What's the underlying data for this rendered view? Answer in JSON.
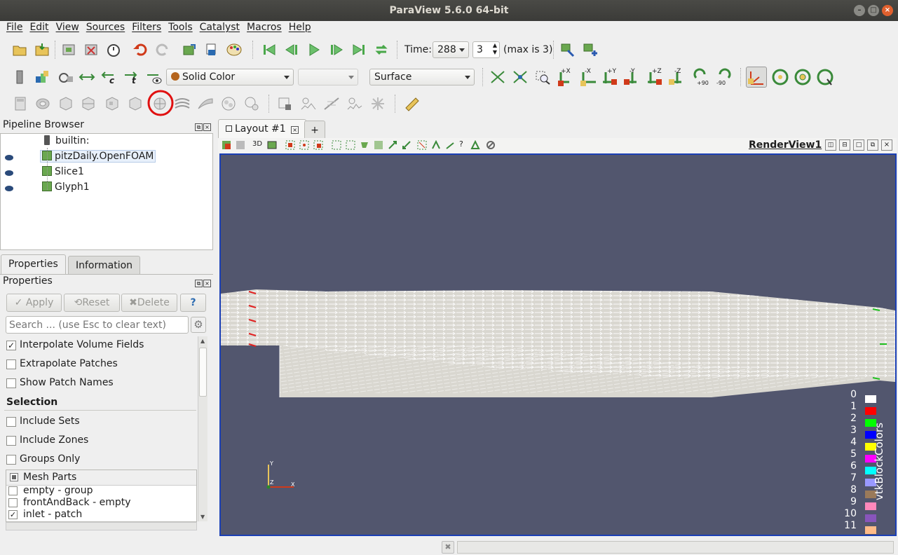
{
  "window": {
    "title": "ParaView 5.6.0 64-bit"
  },
  "menu": [
    "File",
    "Edit",
    "View",
    "Sources",
    "Filters",
    "Tools",
    "Catalyst",
    "Macros",
    "Help"
  ],
  "time": {
    "label": "Time:",
    "value": "288",
    "index": "3",
    "max_text": "(max is 3)"
  },
  "toolbar2": {
    "color_by": "Solid Color",
    "component": "",
    "representation": "Surface",
    "cam_labels": [
      "+X",
      "-X",
      "+Y",
      "-Y",
      "+Z",
      "-Z",
      "+90",
      "-90"
    ]
  },
  "pipeline": {
    "title": "Pipeline Browser",
    "items": [
      {
        "label": "builtin:"
      },
      {
        "label": "pitzDaily.OpenFOAM"
      },
      {
        "label": "Slice1"
      },
      {
        "label": "Glyph1"
      }
    ]
  },
  "props_tabs": [
    "Properties",
    "Information"
  ],
  "properties": {
    "title": "Properties",
    "apply": "Apply",
    "reset": "Reset",
    "delete": "Delete",
    "help": "?",
    "search_placeholder": "Search ... (use Esc to clear text)",
    "checks": [
      {
        "label": "Interpolate Volume Fields",
        "checked": true
      },
      {
        "label": "Extrapolate Patches",
        "checked": false
      },
      {
        "label": "Show Patch Names",
        "checked": false
      }
    ],
    "selection_header": "Selection",
    "selection_checks": [
      {
        "label": "Include Sets",
        "checked": false
      },
      {
        "label": "Include Zones",
        "checked": false
      },
      {
        "label": "Groups Only",
        "checked": false
      }
    ],
    "mesh_parts_header": "Mesh Parts",
    "mesh_parts": [
      {
        "label": "empty - group",
        "checked": false
      },
      {
        "label": "frontAndBack - empty",
        "checked": false
      },
      {
        "label": "inlet - patch",
        "checked": true
      }
    ]
  },
  "layout": {
    "tab": "Layout #1",
    "add_tab": "+",
    "view_label": "RenderView1",
    "mode_3d": "3D"
  },
  "axes": {
    "y": "Y",
    "z": "Z",
    "x": "X"
  },
  "legend": {
    "title": "vtkBlockColors",
    "entries": [
      {
        "n": "0",
        "color": "#ffffff"
      },
      {
        "n": "1",
        "color": "#ff0000"
      },
      {
        "n": "2",
        "color": "#00ff00"
      },
      {
        "n": "3",
        "color": "#0000ff"
      },
      {
        "n": "4",
        "color": "#ffff00"
      },
      {
        "n": "5",
        "color": "#ff00ff"
      },
      {
        "n": "6",
        "color": "#00ffff"
      },
      {
        "n": "7",
        "color": "#9999ff"
      },
      {
        "n": "8",
        "color": "#9a7a5a"
      },
      {
        "n": "9",
        "color": "#ff88bb"
      },
      {
        "n": "10",
        "color": "#8855bb"
      },
      {
        "n": "11",
        "color": "#ffbb88"
      }
    ]
  }
}
